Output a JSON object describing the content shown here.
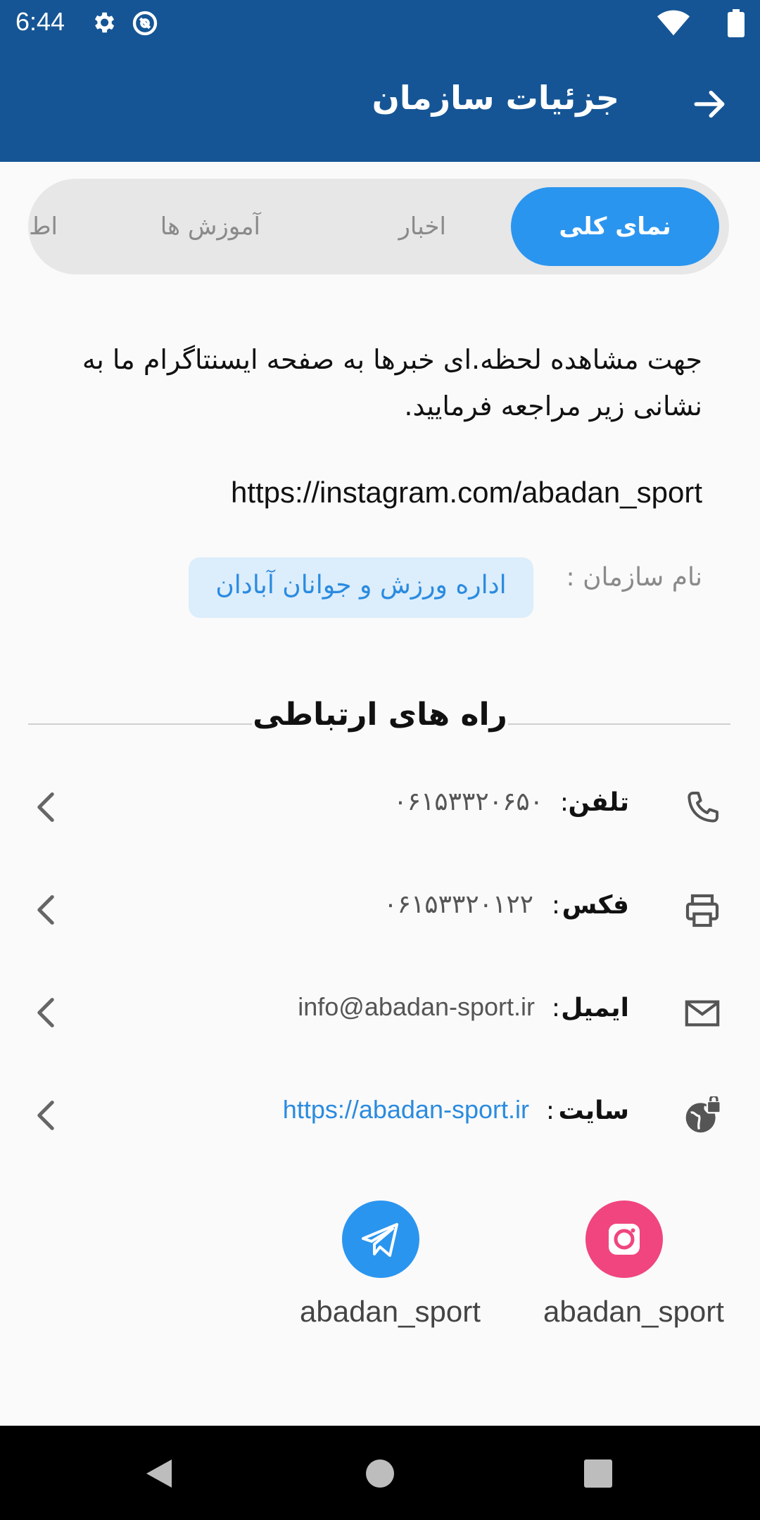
{
  "status": {
    "time": "6:44"
  },
  "header": {
    "title": "جزئیات سازمان"
  },
  "tabs": [
    {
      "label": "نمای کلی",
      "active": true
    },
    {
      "label": "اخبار",
      "active": false
    },
    {
      "label": "آموزش ها",
      "active": false
    },
    {
      "label": "اط",
      "active": false
    }
  ],
  "overview": {
    "description": "جهت مشاهده لحظه.ای خبرها به صفحه ایسنتاگرام ما به نشانی زیر مراجعه فرمایید.",
    "instagram_url": "https://instagram.com/abadan_sport",
    "org_label": "نام سازمان :",
    "org_name": "اداره ورزش و جوانان آبادان"
  },
  "contact": {
    "title": "راه های ارتباطی",
    "colon": ":",
    "rows": [
      {
        "label": "تلفن",
        "value": "۰۶۱۵۳۳۲۰۶۵۰",
        "icon": "phone-icon"
      },
      {
        "label": "فکس",
        "value": "۰۶۱۵۳۳۲۰۱۲۲",
        "icon": "printer-icon"
      },
      {
        "label": "ایمیل",
        "value": "info@abadan-sport.ir",
        "icon": "mail-icon"
      },
      {
        "label": "سایت",
        "value": "https://abadan-sport.ir",
        "icon": "globe-lock-icon"
      }
    ]
  },
  "social": [
    {
      "name": "instagram",
      "handle": "abadan_sport",
      "color": "#f0457f"
    },
    {
      "name": "telegram",
      "handle": "abadan_sport",
      "color": "#2a95ef"
    }
  ],
  "colors": {
    "primary": "#155595",
    "accent": "#2a95ef"
  }
}
